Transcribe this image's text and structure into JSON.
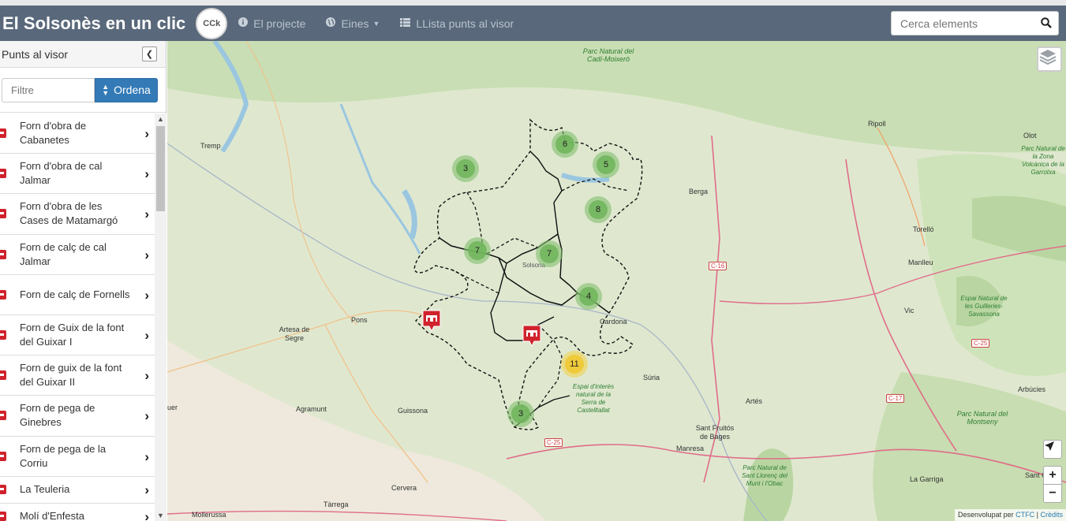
{
  "navbar": {
    "brand": "El Solsonès en un clic",
    "logo_text": "CCk",
    "links": [
      {
        "icon": "info-icon",
        "label": "El projecte"
      },
      {
        "icon": "globe-icon",
        "label": "Eines"
      },
      {
        "icon": "list-icon",
        "label": "LLista punts al visor"
      }
    ],
    "search_placeholder": "Cerca elements"
  },
  "sidebar": {
    "title": "Punts al visor",
    "filter_placeholder": "Filtre",
    "sort_label": "Ordena",
    "items": [
      "Forn d'obra de Cabanetes",
      "Forn d'obra de cal Jalmar",
      "Forn d'obra de les Cases de Matamargó",
      "Forn de calç de cal Jalmar",
      "Forn de calç de Fornells",
      "Forn de Guix de la font del Guixar I",
      "Forn de guix de la font del Guixar II",
      "Forn de pega de Ginebres",
      "Forn de pega de la Corriu",
      "La Teuleria",
      "Molí d'Enfesta"
    ]
  },
  "map": {
    "places": {
      "tremp": "Tremp",
      "ripoll": "Ripoll",
      "olot": "Olot",
      "berga": "Berga",
      "torello": "Torelló",
      "manlleu": "Manlleu",
      "vic": "Vic",
      "pons": "Pons",
      "artesa": "Artesa de Segre",
      "cardona": "Cardona",
      "solsona": "Solsona",
      "suria": "Súria",
      "artes": "Artés",
      "arbucies": "Arbúcies",
      "agramunt": "Agramunt",
      "guissona": "Guissona",
      "santfruitos": "Sant Fruitós de Bages",
      "manresa": "Manresa",
      "cervera": "Cervera",
      "tarrega": "Tàrrega",
      "mollerussa": "Mollerussa",
      "lagarriga": "La Garriga",
      "santceloni": "Sant Celoni",
      "uer": "uer"
    },
    "parks": {
      "cadi": "Parc Natural del Cadí-Moixeró",
      "garrotxa": "Parc Natural de la Zona Volcànica de la Garrotxa",
      "guilleries": "Espai Natural de les Guilleries-Savassona",
      "castelltallat": "Espai d'interès natural de la Serra de Castelltallat",
      "montseny": "Parc Natural del Montseny",
      "santllorenc": "Parc Natural de Sant Llorenç del Munt i l'Obac"
    },
    "roads": {
      "c16": "C-16",
      "c25a": "C-25",
      "c25b": "C-25",
      "c17": "C-17"
    },
    "clusters": {
      "c6": "6",
      "c5": "5",
      "c3a": "3",
      "c8": "8",
      "c7a": "7",
      "c7b": "7",
      "c4": "4",
      "c11": "11",
      "c3b": "3"
    },
    "controls": {
      "zoom_in": "+",
      "zoom_out": "−"
    },
    "attribution": {
      "prefix": "Desenvolupat per",
      "link1": "CTFC",
      "sep": "|",
      "link2": "Crèdits"
    }
  }
}
